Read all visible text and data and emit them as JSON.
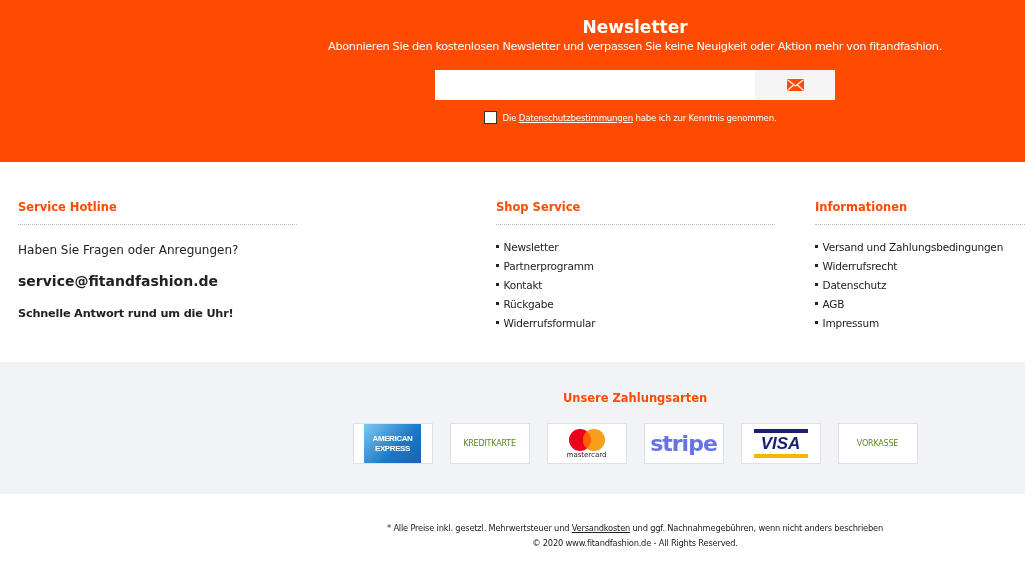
{
  "newsletter": {
    "title": "Newsletter",
    "subtitle": "Abonnieren Sie den kostenlosen Newsletter und verpassen Sie keine Neuigkeit oder Aktion mehr von fitandfashion.",
    "consent": {
      "checked": false,
      "before": "Die ",
      "link": "Datenschutzbestimmungen",
      "after": " habe ich zur Kenntnis genommen."
    }
  },
  "hotline": {
    "title": "Service Hotline",
    "question": "Haben Sie Fragen oder Anregungen?",
    "email": "service@fitandfashion.de",
    "note": "Schnelle Antwort rund um die Uhr!"
  },
  "link_columns": [
    {
      "title": "Shop Service",
      "items": [
        "Newsletter",
        "Partnerprogramm",
        "Kontakt",
        "Rückgabe",
        "Widerrufsformular"
      ]
    },
    {
      "title": "Informationen",
      "items": [
        "Versand und Zahlungsbedingungen",
        "Widerrufsrecht",
        "Datenschutz",
        "AGB",
        "Impressum"
      ]
    }
  ],
  "payments": {
    "title": "Unsere Zahlungsarten",
    "methods": [
      {
        "kind": "amex",
        "label": "AMERICAN EXPRESS"
      },
      {
        "kind": "generic",
        "label": "KREDITKARTE"
      },
      {
        "kind": "mastercard",
        "label": "mastercard"
      },
      {
        "kind": "stripe",
        "label": "stripe"
      },
      {
        "kind": "visa",
        "label": "VISA"
      },
      {
        "kind": "generic",
        "label": "VORKASSE"
      }
    ]
  },
  "footer": {
    "before": "* Alle Preise inkl. gesetzl. Mehrwertsteuer und ",
    "link": "Versandkosten",
    "after": " und ggf. Nachnahmegebühren, wenn nicht anders beschrieben",
    "copyright": "© 2020 www.fitandfashion.de - All Rights Reserved."
  }
}
